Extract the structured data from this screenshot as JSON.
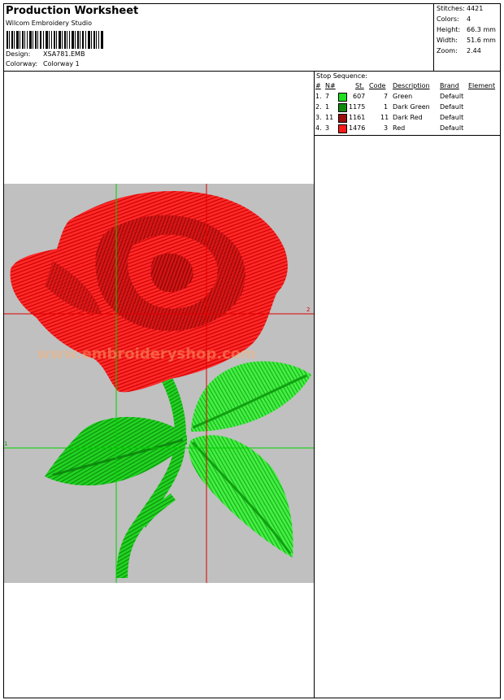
{
  "header": {
    "title": "Production Worksheet",
    "software": "Wilcom  Embroidery Studio",
    "design_label": "Design:",
    "design_value": "XSA781.EMB",
    "colorway_label": "Colorway:",
    "colorway_value": "Colorway 1"
  },
  "stats": {
    "stitches_label": "Stitches:",
    "stitches_value": "4421",
    "colors_label": "Colors:",
    "colors_value": "4",
    "height_label": "Height:",
    "height_value": "66.3 mm",
    "width_label": "Width:",
    "width_value": "51.6 mm",
    "zoom_label": "Zoom:",
    "zoom_value": "2.44"
  },
  "stop_sequence": {
    "title": "Stop Sequence:",
    "headers": {
      "num": "#",
      "n": "N#",
      "st": "St.",
      "code": "Code",
      "description": "Description",
      "brand": "Brand",
      "element": "Element"
    },
    "rows": [
      {
        "num": "1.",
        "n": "7",
        "color": "#1ee01e",
        "st": "607",
        "code": "7",
        "description": "Green",
        "brand": "Default"
      },
      {
        "num": "2.",
        "n": "1",
        "color": "#0f8a0f",
        "st": "1175",
        "code": "1",
        "description": "Dark Green",
        "brand": "Default"
      },
      {
        "num": "3.",
        "n": "11",
        "color": "#9c0d0d",
        "st": "1161",
        "code": "11",
        "description": "Dark Red",
        "brand": "Default"
      },
      {
        "num": "4.",
        "n": "3",
        "color": "#ff1a1a",
        "st": "1476",
        "code": "3",
        "description": "Red",
        "brand": "Default"
      }
    ]
  },
  "canvas": {
    "marker_right": "2",
    "marker_left": "1",
    "watermark": "www.embroideryshop.com"
  }
}
